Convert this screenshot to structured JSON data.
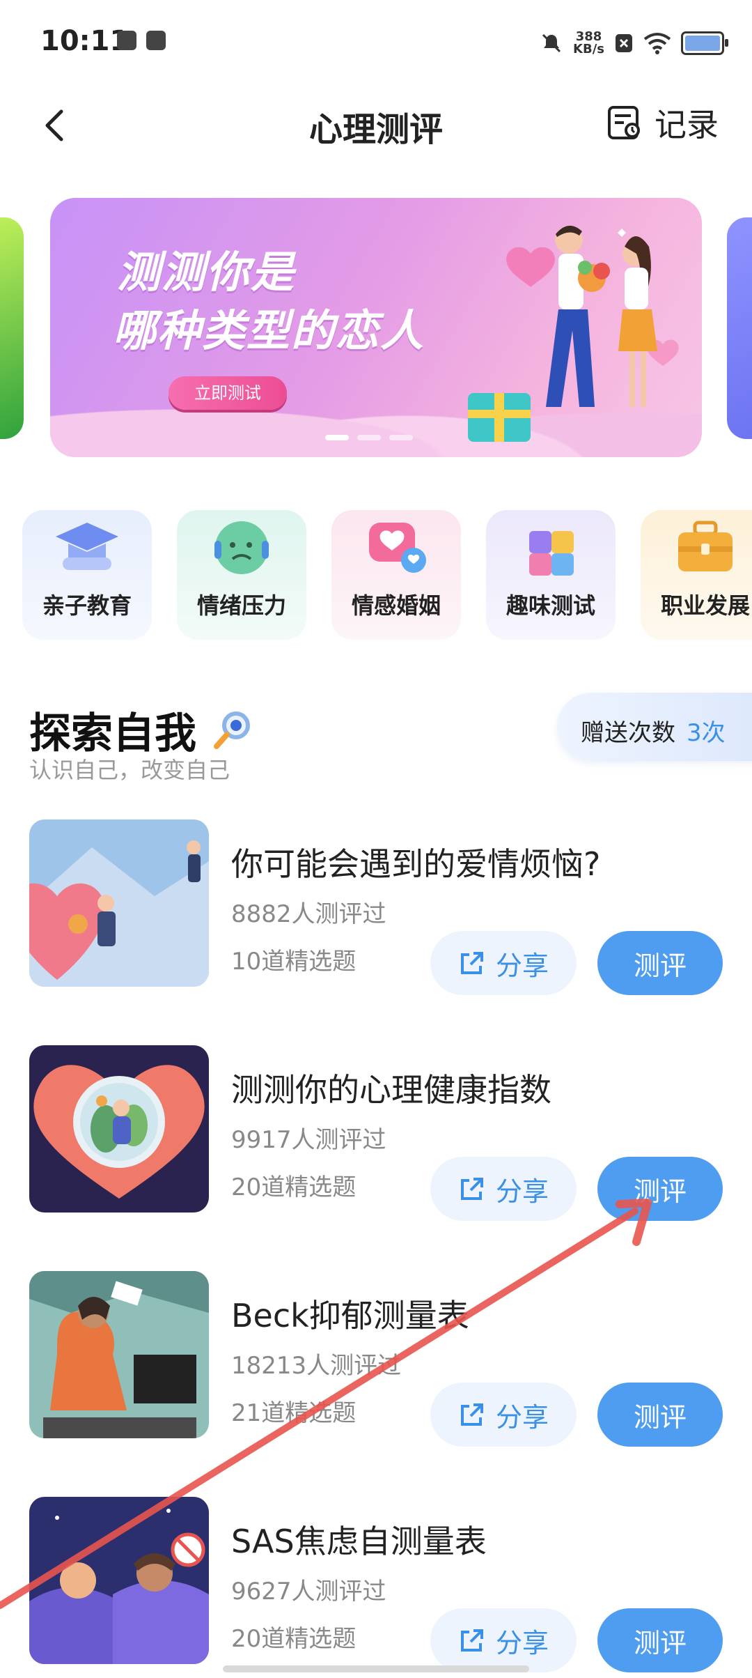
{
  "status_bar": {
    "time": "10:11",
    "net_speed_value": "388",
    "net_speed_unit": "KB/s"
  },
  "header": {
    "title": "心理测评",
    "record_label": "记录"
  },
  "banner": {
    "line1": "测测你是",
    "line2": "哪种类型的恋人",
    "cta": "立即测试",
    "active_dot": 0
  },
  "categories": [
    {
      "label": "亲子教育",
      "icon": "graduation-cap-icon"
    },
    {
      "label": "情绪压力",
      "icon": "sad-face-icon"
    },
    {
      "label": "情感婚姻",
      "icon": "heart-chat-icon"
    },
    {
      "label": "趣味测试",
      "icon": "puzzle-icon"
    },
    {
      "label": "职业发展",
      "icon": "briefcase-icon"
    }
  ],
  "section": {
    "title": "探索自我",
    "subtitle": "认识自己，改变自己",
    "bonus_label": "赠送次数",
    "bonus_count": "3次"
  },
  "tests": [
    {
      "title": "你可能会遇到的爱情烦恼?",
      "count": "8882人测评过",
      "questions": "10道精选题",
      "share": "分享",
      "action": "测评"
    },
    {
      "title": "测测你的心理健康指数",
      "count": "9917人测评过",
      "questions": "20道精选题",
      "share": "分享",
      "action": "测评"
    },
    {
      "title": "Beck抑郁测量表",
      "count": "18213人测评过",
      "questions": "21道精选题",
      "share": "分享",
      "action": "测评"
    },
    {
      "title": "SAS焦虑自测量表",
      "count": "9627人测评过",
      "questions": "20道精选题",
      "share": "分享",
      "action": "测评"
    }
  ],
  "colors": {
    "accent": "#4f9df0",
    "share_bg": "#eef4fd",
    "annotation_arrow": "#e8554e"
  }
}
